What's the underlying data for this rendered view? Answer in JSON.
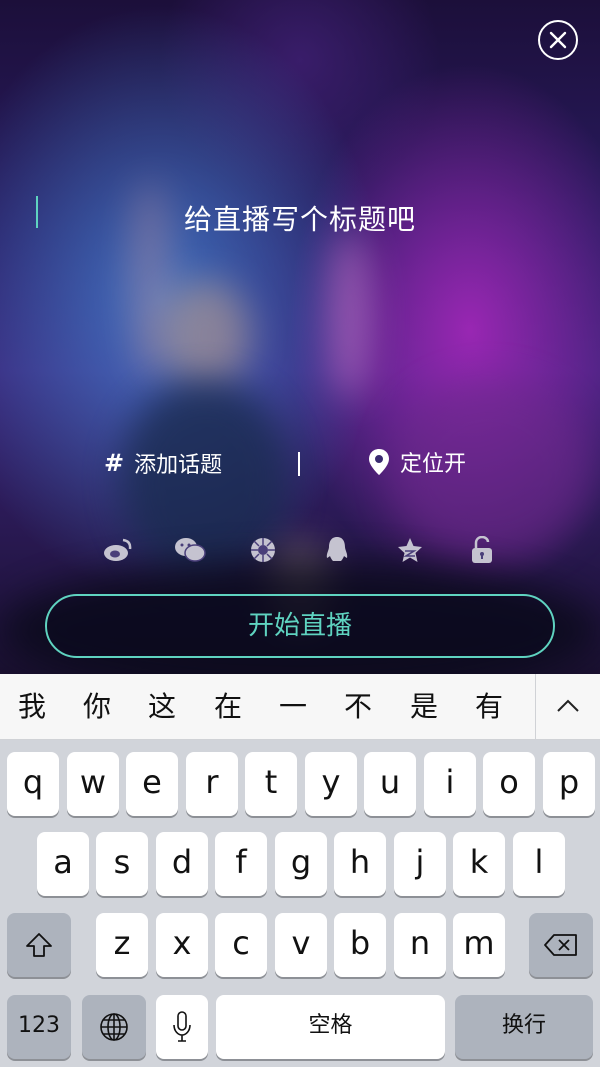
{
  "live": {
    "title_placeholder": "给直播写个标题吧",
    "topic_label": "添加话题",
    "topic_icon": "#",
    "location_label": "定位开",
    "start_button": "开始直播",
    "accent_color": "#5fd3c0",
    "share_icons": [
      "weibo-icon",
      "wechat-icon",
      "moments-icon",
      "qq-icon",
      "qzone-icon",
      "lock-icon"
    ]
  },
  "candidates": [
    "我",
    "你",
    "这",
    "在",
    "一",
    "不",
    "是",
    "有"
  ],
  "keyboard": {
    "row1": [
      "q",
      "w",
      "e",
      "r",
      "t",
      "y",
      "u",
      "i",
      "o",
      "p"
    ],
    "row2": [
      "a",
      "s",
      "d",
      "f",
      "g",
      "h",
      "j",
      "k",
      "l"
    ],
    "row3": [
      "z",
      "x",
      "c",
      "v",
      "b",
      "n",
      "m"
    ],
    "num_key": "123",
    "space_key": "空格",
    "return_key": "换行"
  }
}
